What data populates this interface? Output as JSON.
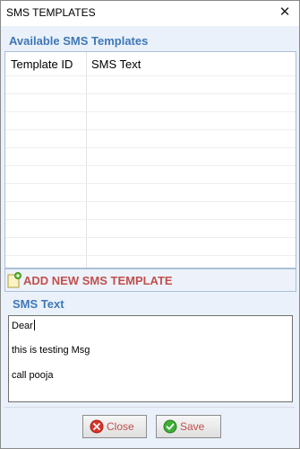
{
  "window": {
    "title": "SMS TEMPLATES",
    "close_glyph": "✕"
  },
  "templates_panel": {
    "title": "Available SMS Templates",
    "columns": [
      "Template ID",
      "SMS Text"
    ],
    "rows": []
  },
  "add_bar": {
    "label": "ADD NEW SMS TEMPLATE",
    "icon": "add-document-icon"
  },
  "sms_editor": {
    "label": "SMS Text",
    "lines": [
      "Dear",
      "this is testing Msg",
      "call pooja"
    ]
  },
  "buttons": {
    "close_label": "Close",
    "save_label": "Save",
    "close_icon": "cancel-circle-icon",
    "save_icon": "check-circle-icon"
  },
  "colors": {
    "accent_blue": "#3f77b8",
    "accent_red": "#c0504d",
    "panel_bg": "#eaf1fa"
  }
}
